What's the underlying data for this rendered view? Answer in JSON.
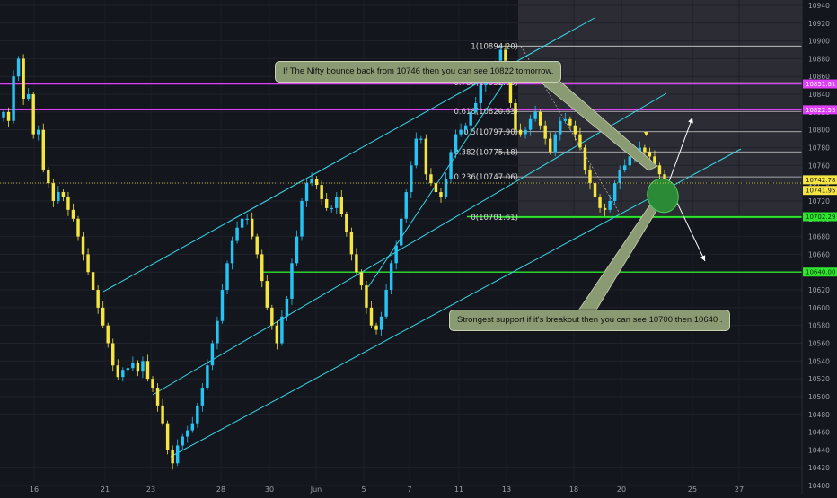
{
  "chart_data": {
    "type": "candlestick",
    "y_axis": {
      "side": "right",
      "range": [
        10396,
        10946
      ],
      "ticks": [
        10400,
        10420,
        10440,
        10460,
        10480,
        10500,
        10520,
        10540,
        10560,
        10580,
        10600,
        10620,
        10640,
        10660,
        10680,
        10700,
        10720,
        10740,
        10760,
        10780,
        10800,
        10820,
        10840,
        10860,
        10880,
        10900,
        10920,
        10940
      ]
    },
    "x_axis": {
      "ticks": [
        "16",
        "21",
        "23",
        "28",
        "30",
        "Jun",
        "5",
        "7",
        "11",
        "13",
        "18",
        "20",
        "25",
        "27"
      ]
    },
    "candles": [
      10820,
      10810,
      10860,
      10880,
      10835,
      10840,
      10795,
      10800,
      10755,
      10740,
      10720,
      10730,
      10725,
      10710,
      10700,
      10680,
      10660,
      10640,
      10620,
      10600,
      10580,
      10560,
      10535,
      10522,
      10530,
      10532,
      10538,
      10528,
      10540,
      10520,
      10510,
      10490,
      10470,
      10440,
      10425,
      10445,
      10455,
      10462,
      10470,
      10490,
      10510,
      10535,
      10560,
      10585,
      10620,
      10650,
      10675,
      10690,
      10700,
      10700,
      10680,
      10660,
      10630,
      10600,
      10580,
      10560,
      10590,
      10610,
      10650,
      10680,
      10720,
      10740,
      10745,
      10738,
      10722,
      10712,
      10712,
      10725,
      10705,
      10685,
      10660,
      10640,
      10625,
      10600,
      10580,
      10575,
      10590,
      10620,
      10650,
      10670,
      10700,
      10730,
      10760,
      10790,
      10790,
      10750,
      10740,
      10730,
      10725,
      10745,
      10775,
      10795,
      10800,
      10805,
      10820,
      10830,
      10850,
      10855,
      10862,
      10875,
      10890,
      10860,
      10830,
      10800,
      10795,
      10800,
      10812,
      10820,
      10805,
      10790,
      10775,
      10795,
      10810,
      10812,
      10805,
      10795,
      10780,
      10755,
      10740,
      10725,
      10712,
      10710,
      10720,
      10740,
      10755,
      10760,
      10770,
      10772,
      10780,
      10775,
      10770,
      10760,
      10750,
      10742
    ],
    "fib_levels": [
      {
        "ratio": "1",
        "value": 10894.2,
        "label": "1(10894.20)"
      },
      {
        "ratio": "0.786",
        "value": 10852.98,
        "label": "0.786(10852.98)"
      },
      {
        "ratio": "0.618",
        "value": 10820.63,
        "label": "0.618(10820.63)"
      },
      {
        "ratio": "0.5",
        "value": 10797.9,
        "label": "0.5(10797.90)"
      },
      {
        "ratio": "0.382",
        "value": 10775.18,
        "label": "0.382(10775.18)"
      },
      {
        "ratio": "0.236",
        "value": 10747.06,
        "label": "0.236(10747.06)"
      },
      {
        "ratio": "0",
        "value": 10701.61,
        "label": "0(10701.61)"
      }
    ],
    "horizontal_lines": [
      {
        "value": 10851.61,
        "color": "#e040fb",
        "tag": "10851.61"
      },
      {
        "value": 10822.53,
        "color": "#e040fb",
        "tag": "10822.53"
      },
      {
        "value": 10702.29,
        "color": "#2ee62e",
        "tag": "10702.29"
      },
      {
        "value": 10640.0,
        "color": "#2ee62e",
        "tag": "10640.00"
      }
    ],
    "price_tags": [
      {
        "value": 10742.78,
        "tag": "10742.78"
      },
      {
        "value": 10741.95,
        "tag": "10741.95"
      }
    ],
    "annotations": [
      "If The Nifty bounce back from 10746 then you can see 10822 tomorrow.",
      "Strongest support if it's breakout then you can see 10700 then 10640 ."
    ],
    "colors": {
      "up": "#27c3f5",
      "down": "#f4e542",
      "channel": "#35d8e8",
      "fib": "#d0d0d0",
      "projection_bg": "#3a3c44",
      "support_ellipse": "#2a8a35"
    }
  }
}
